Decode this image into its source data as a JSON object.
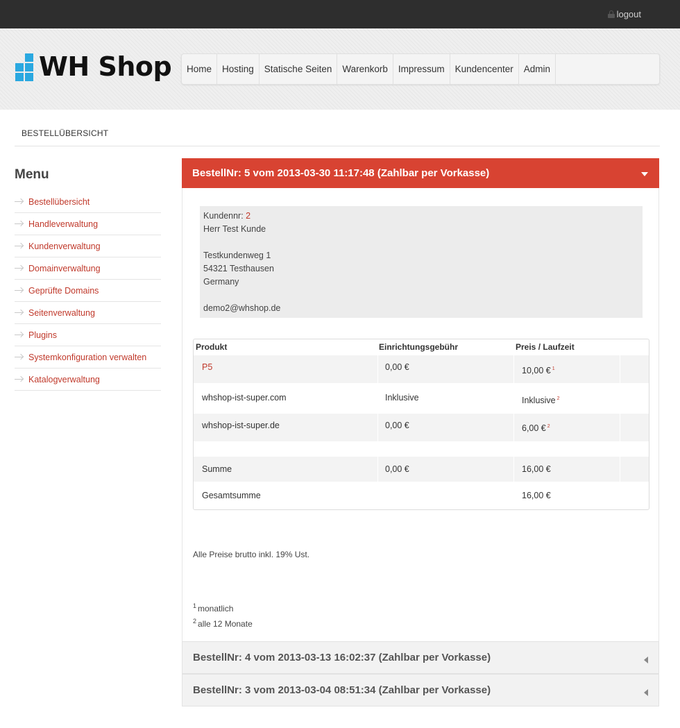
{
  "topbar": {
    "logout_label": "logout"
  },
  "brand": {
    "name": "WH Shop",
    "accent_color": "#2aa8e0"
  },
  "nav": {
    "items": [
      {
        "label": "Home"
      },
      {
        "label": "Hosting"
      },
      {
        "label": "Statische Seiten"
      },
      {
        "label": "Warenkorb"
      },
      {
        "label": "Impressum"
      },
      {
        "label": "Kundencenter"
      },
      {
        "label": "Admin"
      }
    ]
  },
  "breadcrumb": {
    "current": "BESTELLÜBERSICHT"
  },
  "sidebar": {
    "title": "Menu",
    "items": [
      {
        "label": "Bestellübersicht"
      },
      {
        "label": "Handleverwaltung"
      },
      {
        "label": "Kundenverwaltung"
      },
      {
        "label": "Domainverwaltung"
      },
      {
        "label": "Geprüfte Domains"
      },
      {
        "label": "Seitenverwaltung"
      },
      {
        "label": "Plugins"
      },
      {
        "label": "Systemkonfiguration verwalten"
      },
      {
        "label": "Katalogverwaltung"
      }
    ]
  },
  "orders": [
    {
      "title": "BestellNr: 5 vom 2013-03-30 11:17:48 (Zahlbar per Vorkasse)",
      "expanded": true,
      "customer": {
        "number_label": "Kundennr:",
        "number": "2",
        "name": "Herr Test Kunde",
        "street": "Testkundenweg 1",
        "city": "54321 Testhausen",
        "country": "Germany",
        "email": "demo2@whshop.de"
      },
      "table": {
        "headers": {
          "product": "Produkt",
          "setup_fee": "Einrichtungsgebühr",
          "price": "Preis / Laufzeit"
        },
        "rows": [
          {
            "product": "P5",
            "setup_fee": "0,00 €",
            "price": "10,00 €",
            "footnote": "1"
          },
          {
            "product": "whshop-ist-super.com",
            "setup_fee": "Inklusive",
            "price": "Inklusive",
            "footnote": "2"
          },
          {
            "product": "whshop-ist-super.de",
            "setup_fee": "0,00 €",
            "price": "6,00 €",
            "footnote": "2"
          }
        ],
        "sum": {
          "label": "Summe",
          "setup_fee": "0,00 €",
          "price": "16,00 €"
        },
        "total": {
          "label": "Gesamtsumme",
          "price": "16,00 €"
        }
      },
      "note": "Alle Preise brutto inkl. 19% Ust.",
      "footnotes": [
        {
          "mark": "1",
          "text": "monatlich"
        },
        {
          "mark": "2",
          "text": "alle 12 Monate"
        }
      ]
    },
    {
      "title": "BestellNr: 4 vom 2013-03-13 16:02:37 (Zahlbar per Vorkasse)",
      "expanded": false
    },
    {
      "title": "BestellNr: 3 vom 2013-03-04 08:51:34 (Zahlbar per Vorkasse)",
      "expanded": false
    }
  ]
}
